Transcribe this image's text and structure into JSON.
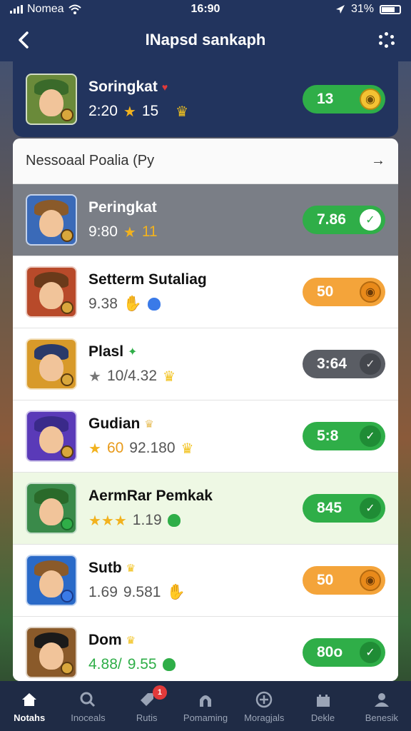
{
  "status_bar": {
    "carrier": "Nomea",
    "time": "16:90",
    "battery": "31%"
  },
  "header": {
    "title": "INapsd sankaph"
  },
  "featured": {
    "name": "Soringkat",
    "meta_left": "2:20",
    "meta_right": "15",
    "pill_value": "13",
    "avatar_color": "#6a8a3a"
  },
  "section": {
    "title": "Nessoaal Poalia (Py"
  },
  "rows": [
    {
      "name": "Peringkat",
      "meta_left": "9:80",
      "meta_right": "11",
      "pill": "7.86",
      "style": "green",
      "avatar_color": "#3a6ab8"
    },
    {
      "name": "Setterm Sutaliag",
      "meta_left": "9.38",
      "meta_right": "",
      "pill": "50",
      "style": "orange",
      "avatar_color": "#b84a2a"
    },
    {
      "name": "Plasl",
      "meta_left": "10/4.32",
      "meta_right": "",
      "pill": "3:64",
      "style": "dark",
      "avatar_color": "#d89a2a"
    },
    {
      "name": "Gudian",
      "meta_left": "60",
      "meta_right": "92.180",
      "pill": "5:8",
      "style": "green",
      "avatar_color": "#5a3ab8"
    },
    {
      "name": "AermRar Pemkak",
      "meta_left": "1.19",
      "meta_right": "",
      "pill": "845",
      "style": "green",
      "avatar_color": "#3a8a4a"
    },
    {
      "name": "Sutb",
      "meta_left": "1.69",
      "meta_right": "9.581",
      "pill": "50",
      "style": "orange",
      "avatar_color": "#2a6ac8"
    },
    {
      "name": "Dom",
      "meta_left": "4.88/",
      "meta_right": "9.55",
      "pill": "80o",
      "style": "green",
      "avatar_color": "#8a5a2a"
    }
  ],
  "tabs": [
    {
      "label": "Notahs",
      "icon": "home-icon"
    },
    {
      "label": "Inoceals",
      "icon": "search-icon"
    },
    {
      "label": "Rutis",
      "icon": "tag-icon",
      "badge": "1"
    },
    {
      "label": "Pomaming",
      "icon": "arch-icon"
    },
    {
      "label": "Moragjals",
      "icon": "plus-circle-icon"
    },
    {
      "label": "Dekle",
      "icon": "castle-icon"
    },
    {
      "label": "Benesik",
      "icon": "user-icon"
    }
  ]
}
